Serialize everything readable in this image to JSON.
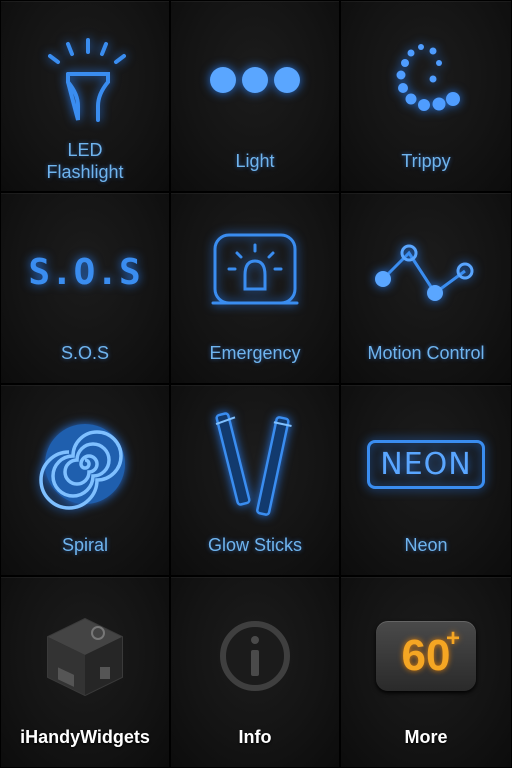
{
  "tiles": [
    {
      "label": "LED\nFlashlight",
      "icon": "flashlight-icon"
    },
    {
      "label": "Light",
      "icon": "light-dots-icon"
    },
    {
      "label": "Trippy",
      "icon": "trippy-dots-icon"
    },
    {
      "label": "S.O.S",
      "icon": "sos-icon",
      "icon_text": "S.O.S"
    },
    {
      "label": "Emergency",
      "icon": "emergency-beacon-icon"
    },
    {
      "label": "Motion Control",
      "icon": "motion-graph-icon"
    },
    {
      "label": "Spiral",
      "icon": "spiral-icon"
    },
    {
      "label": "Glow Sticks",
      "icon": "glow-sticks-icon"
    },
    {
      "label": "Neon",
      "icon": "neon-sign-icon",
      "icon_text": "NEON"
    },
    {
      "label": "iHandyWidgets",
      "icon": "widget-cube-icon"
    },
    {
      "label": "Info",
      "icon": "info-icon"
    },
    {
      "label": "More",
      "icon": "sixty-plus-icon",
      "icon_text": "60",
      "icon_sup": "+"
    }
  ],
  "colors": {
    "accent": "#2f8fff",
    "label": "#6fb4ee",
    "white_label": "#ffffff",
    "more_badge": "#f5a623"
  }
}
